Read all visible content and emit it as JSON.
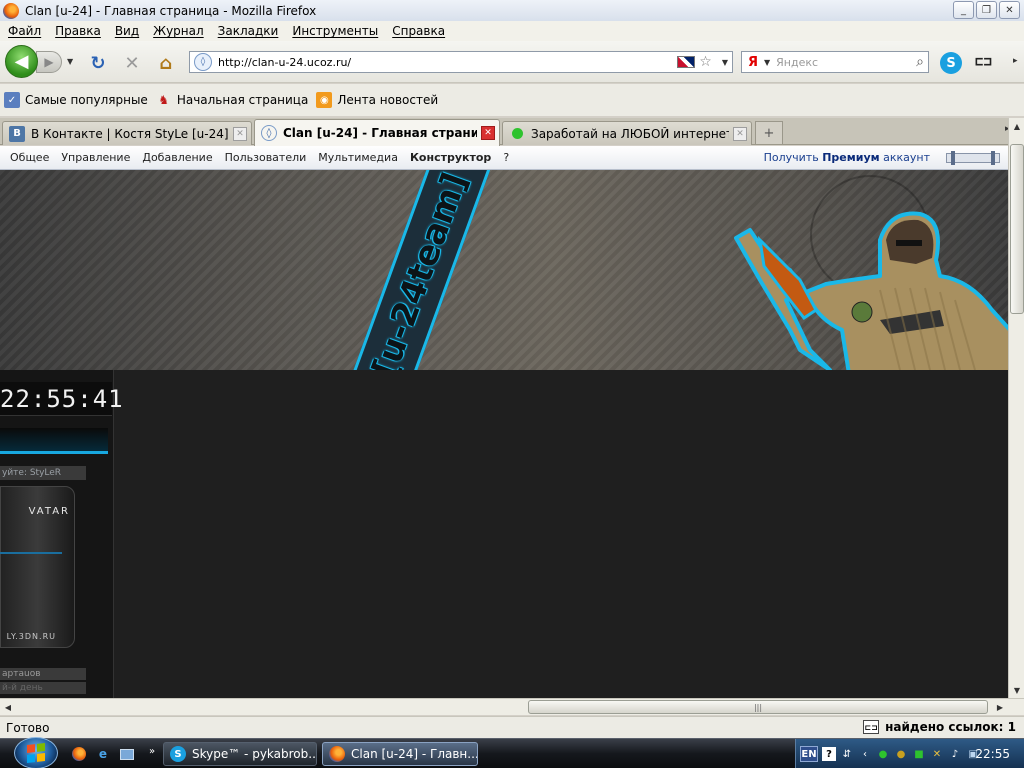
{
  "window": {
    "title": "Clan [u-24] - Главная страница - Mozilla Firefox",
    "btn_min": "_",
    "btn_max": "❐",
    "btn_close": "✕"
  },
  "menu": {
    "file": "Файл",
    "edit": "Правка",
    "view": "Вид",
    "history": "Журнал",
    "bookmarks": "Закладки",
    "tools": "Инструменты",
    "help": "Справка"
  },
  "nav": {
    "url": "http://clan-u-24.ucoz.ru/",
    "search_placeholder": "Яндекс",
    "search_engine_icon": "Я"
  },
  "bookmarks": [
    {
      "label": "Самые популярные",
      "icon": "popular-icon"
    },
    {
      "label": "Начальная страница",
      "icon": "start-page-icon"
    },
    {
      "label": "Лента новостей",
      "icon": "rss-icon"
    }
  ],
  "tabs": [
    {
      "label": "В Контакте | Костя StyLe [u-24] К...",
      "icon": "vk-icon",
      "active": false
    },
    {
      "label": "Clan [u-24] - Главная страни...",
      "icon": "ucoz-icon",
      "active": true
    },
    {
      "label": "Заработай на ЛЮБОЙ интернет...",
      "icon": "green-dot-icon",
      "active": false
    }
  ],
  "ucoz_bar": {
    "items": [
      "Общее",
      "Управление",
      "Добавление",
      "Пользователи",
      "Мультимедиа",
      "Конструктор",
      "?"
    ],
    "premium_prefix": "Получить",
    "premium_bold": "Премиум",
    "premium_suffix": "аккаунт"
  },
  "site": {
    "banner_text": "[u-24team]",
    "clock": "22:55:41",
    "welcome": "уйте: StyLeR",
    "avatar_label": "VATAR",
    "avatar_site": "LY.3DN.RU",
    "side_row_1": "артаuов",
    "side_row_2": "й-й день"
  },
  "status": {
    "left": "Готово",
    "right": "найдено ссылок: 1"
  },
  "taskbar": {
    "tasks": [
      {
        "label": "Skype™ - pykabrob...",
        "icon": "skype-icon"
      },
      {
        "label": "Clan [u-24] - Главн...",
        "icon": "firefox-icon"
      }
    ],
    "lang": "EN",
    "time": "22:55"
  },
  "colors": {
    "accent_cyan": "#1ab8e8",
    "page_bg": "#1f1f1f"
  }
}
